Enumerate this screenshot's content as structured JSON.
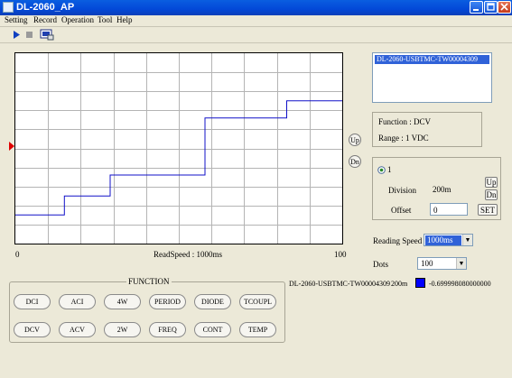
{
  "window": {
    "title": "DL-2060_AP"
  },
  "menu": [
    "Setting",
    "Record",
    "Operation",
    "Tool",
    "Help"
  ],
  "graph": {
    "xmin_label": "0",
    "xmax_label": "100",
    "read_speed": "ReadSpeed : 1000ms",
    "up_label": "Up",
    "dn_label": "Dn",
    "trace_color": "#1010c8",
    "trace_steps": [
      {
        "from": 0,
        "to": 15,
        "level": 0.15
      },
      {
        "from": 15,
        "to": 29,
        "level": 0.25
      },
      {
        "from": 29,
        "to": 58,
        "level": 0.36
      },
      {
        "from": 58,
        "to": 83,
        "level": 0.66
      },
      {
        "from": 83,
        "to": 100,
        "level": 0.75
      }
    ]
  },
  "device_list": {
    "items": [
      "DL-2060-USBTMC-TW00004309"
    ]
  },
  "info": {
    "function": "Function : DCV",
    "range": "Range : 1  VDC"
  },
  "channel": {
    "radio_label": "1",
    "division_label": "Division",
    "division_value": "200m",
    "offset_label": "Offset",
    "offset_value": "0",
    "up": "Up",
    "dn": "Dn",
    "set": "SET"
  },
  "reading_speed": {
    "label": "Reading Speed",
    "value": "1000ms"
  },
  "dots": {
    "label": "Dots",
    "value": "100"
  },
  "status": {
    "device": "DL-2060-USBTMC-TW00004309",
    "division": "200m",
    "swatch_color": "#0000ff",
    "reading": "-0.699998080000000"
  },
  "function": {
    "title": "FUNCTION",
    "row1": [
      "DCI",
      "ACI",
      "4W",
      "PERIOD",
      "DIODE",
      "TCOUPL"
    ],
    "row2": [
      "DCV",
      "ACV",
      "2W",
      "FREQ",
      "CONT",
      "TEMP"
    ]
  }
}
